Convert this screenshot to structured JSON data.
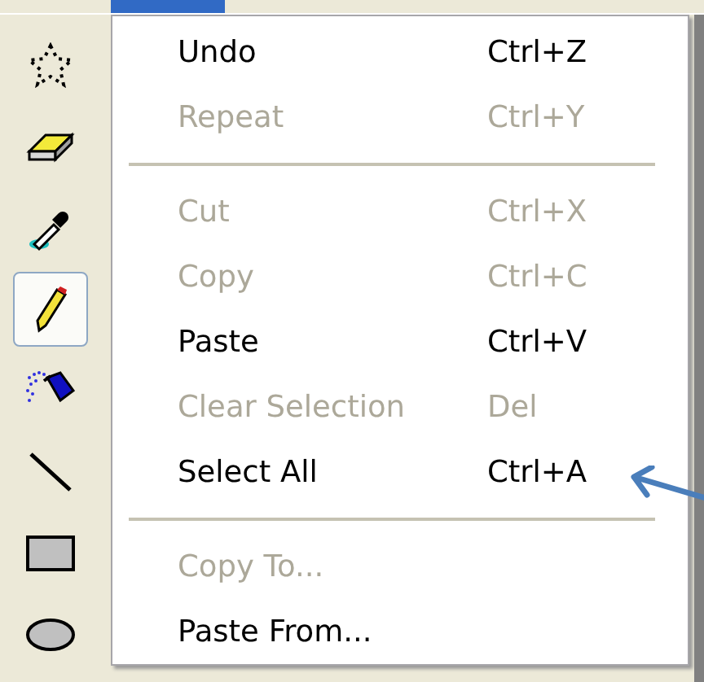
{
  "toolbox": [
    {
      "kind": "free-select",
      "selected": false
    },
    {
      "kind": "eraser",
      "selected": false
    },
    {
      "kind": "picker",
      "selected": false
    },
    {
      "kind": "pencil",
      "selected": true
    },
    {
      "kind": "airbrush",
      "selected": false
    },
    {
      "kind": "line",
      "selected": false
    },
    {
      "kind": "rectangle",
      "selected": false
    },
    {
      "kind": "ellipse",
      "selected": false
    }
  ],
  "edit_menu": [
    {
      "kind": "item",
      "label": "Undo",
      "shortcut": "Ctrl+Z",
      "disabled": false
    },
    {
      "kind": "item",
      "label": "Repeat",
      "shortcut": "Ctrl+Y",
      "disabled": true
    },
    {
      "kind": "separator"
    },
    {
      "kind": "item",
      "label": "Cut",
      "shortcut": "Ctrl+X",
      "disabled": true
    },
    {
      "kind": "item",
      "label": "Copy",
      "shortcut": "Ctrl+C",
      "disabled": true
    },
    {
      "kind": "item",
      "label": "Paste",
      "shortcut": "Ctrl+V",
      "disabled": false
    },
    {
      "kind": "item",
      "label": "Clear Selection",
      "shortcut": "Del",
      "disabled": true
    },
    {
      "kind": "item",
      "label": "Select All",
      "shortcut": "Ctrl+A",
      "disabled": false
    },
    {
      "kind": "separator"
    },
    {
      "kind": "item",
      "label": "Copy To...",
      "disabled": true
    },
    {
      "kind": "item",
      "label": "Paste From...",
      "disabled": false
    }
  ]
}
